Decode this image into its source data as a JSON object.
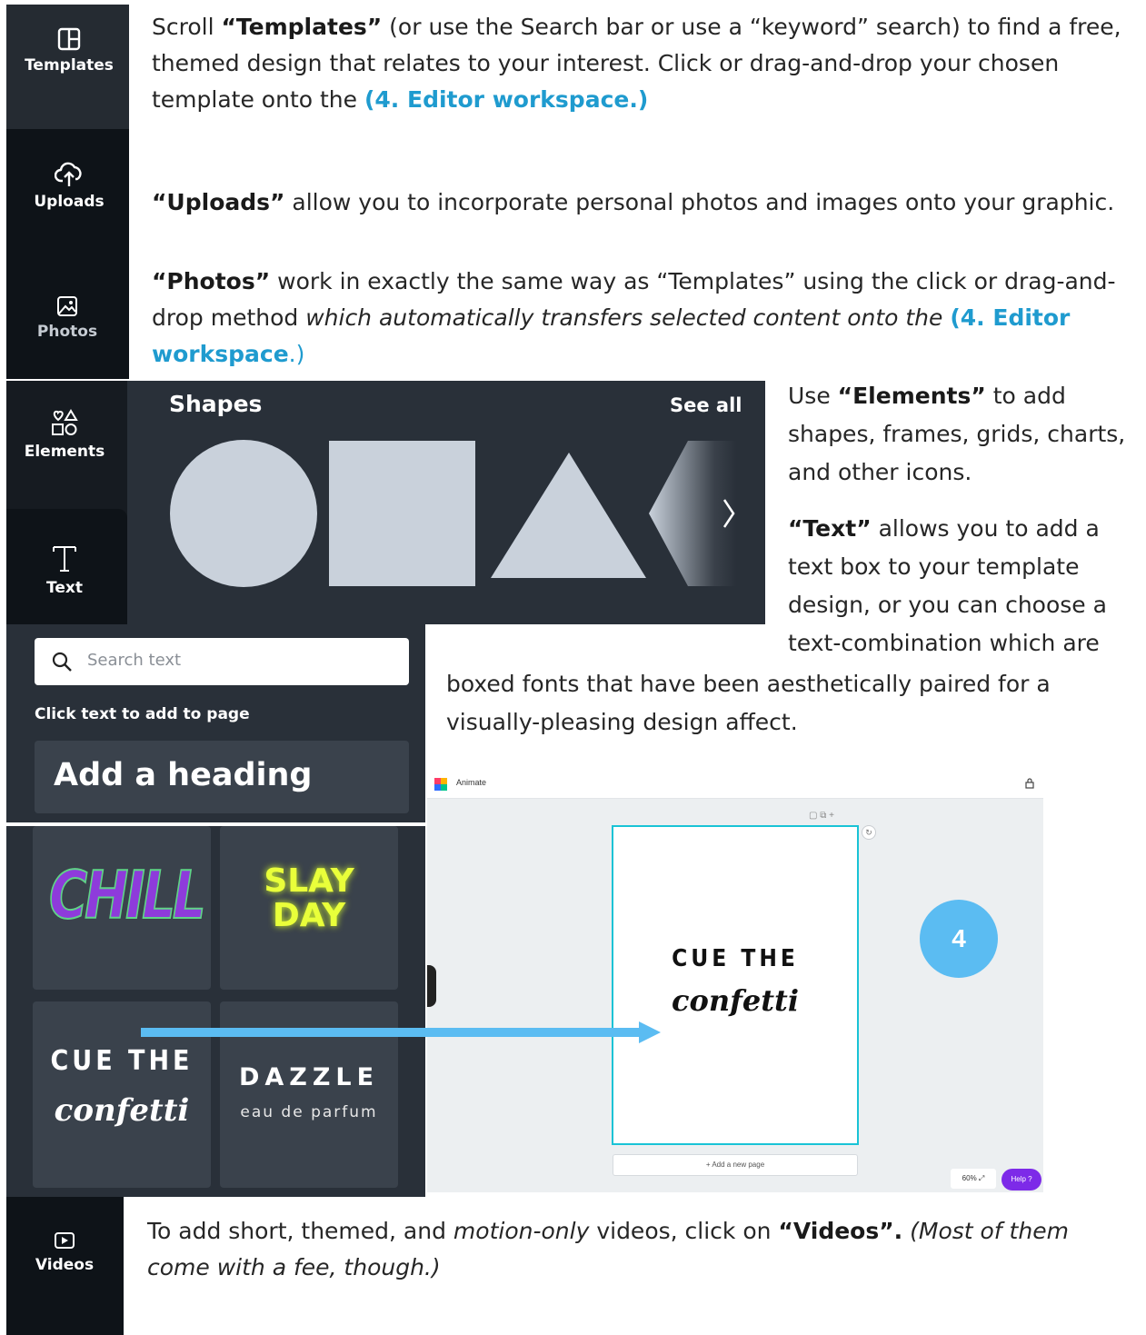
{
  "sidebar_top": {
    "templates_label": "Templates",
    "uploads_label": "Uploads",
    "photos_label": "Photos"
  },
  "para_templates": {
    "t1": "Scroll ",
    "b1": "“Templates”",
    "t2": " (or use the Search bar or use a “keyword” search) to find a free, themed design that relates to your interest.  Click or drag-and-drop your chosen template onto the ",
    "link": "(4. Editor workspace.)"
  },
  "para_uploads": {
    "b1": "“Uploads”",
    "t1": " allow you to incorporate personal photos and images onto your graphic."
  },
  "para_photos": {
    "b1": "“Photos”",
    "t1": " work in exactly the same way as “Templates” using the click or drag-and-drop method ",
    "i1": "which automatically transfers selected content onto the ",
    "link1": "(4. Editor workspace",
    "t2": ".)"
  },
  "elements_panel": {
    "elements_label": "Elements",
    "text_label": "Text",
    "shapes_heading": "Shapes",
    "see_all": "See all"
  },
  "para_elements": {
    "t1": "Use ",
    "b1": "“Elements”",
    "t2": " to add shapes, frames, grids, charts, and other icons."
  },
  "para_text": {
    "b1": "“Text”",
    "t1": " allows you to add a text box to your template design, or you can choose a text-combination which are",
    "t2": "boxed fonts that have been aesthetically paired for a visually-pleasing design affect."
  },
  "text_panel": {
    "search_placeholder": "Search text",
    "hint": "Click text to add to page",
    "heading_button": "Add a heading",
    "tiles": {
      "chill": "CHILL",
      "slay_1": "SLAY",
      "slay_2": "DAY",
      "cue_1": "CUE THE",
      "cue_2": "confetti",
      "dazzle_1": "DAZZLE",
      "dazzle_2": "eau de parfum"
    }
  },
  "editor": {
    "title": "Animate",
    "page_text_1": "CUE THE",
    "page_text_2": "confetti",
    "add_page": "+ Add a new page",
    "zoom": "60%",
    "help": "Help ?",
    "badge": "4"
  },
  "videos": {
    "label": "Videos",
    "t1": "To add short, themed, and ",
    "i1": "motion-only",
    "t2": " videos, click on ",
    "b1": "“Videos”.",
    "i2": " (Most of them come with a fee, though.)"
  },
  "colors": {
    "sidebar_bg": "#0e1318",
    "panel_bg": "#293039",
    "link_blue": "#1f9bcf",
    "arrow_blue": "#5bbcf2",
    "help_purple": "#7d2ae8",
    "page_border": "#19c3d6"
  }
}
